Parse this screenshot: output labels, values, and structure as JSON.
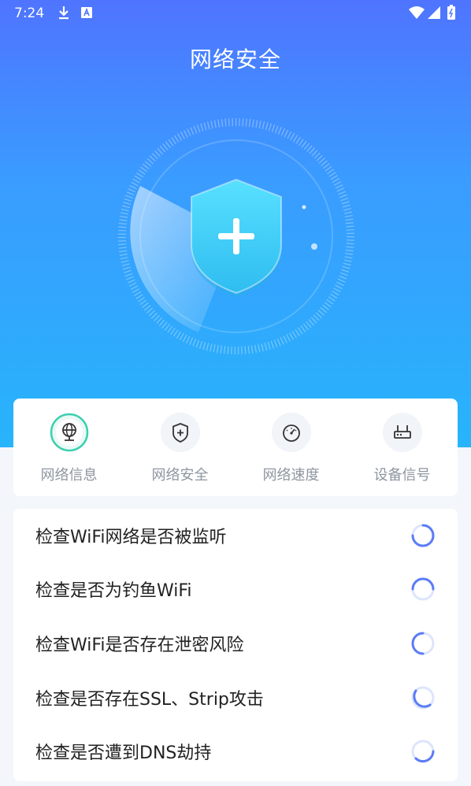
{
  "status_bar": {
    "time": "7:24",
    "icons": [
      "download-icon",
      "a-icon",
      "wifi-icon",
      "signal-icon",
      "battery-icon"
    ]
  },
  "header": {
    "title": "网络安全"
  },
  "hero": {
    "icon": "shield-plus-icon"
  },
  "tabs": [
    {
      "label": "网络信息",
      "icon": "globe-network-icon",
      "active": true
    },
    {
      "label": "网络安全",
      "icon": "shield-plus-icon",
      "active": false
    },
    {
      "label": "网络速度",
      "icon": "speedometer-icon",
      "active": false
    },
    {
      "label": "设备信号",
      "icon": "router-icon",
      "active": false
    }
  ],
  "checks": [
    {
      "label": "检查WiFi网络是否被监听",
      "status": "loading"
    },
    {
      "label": "检查是否为钓鱼WiFi",
      "status": "loading"
    },
    {
      "label": "检查WiFi是否存在泄密风险",
      "status": "loading"
    },
    {
      "label": "检查是否存在SSL、Strip攻击",
      "status": "loading"
    },
    {
      "label": "检查是否遭到DNS劫持",
      "status": "loading"
    }
  ],
  "colors": {
    "hero_top": "#4f74ff",
    "hero_bottom": "#27b4fb",
    "spinner": "#5b7cf5",
    "active_tab_ring": "#3ccfb0"
  }
}
